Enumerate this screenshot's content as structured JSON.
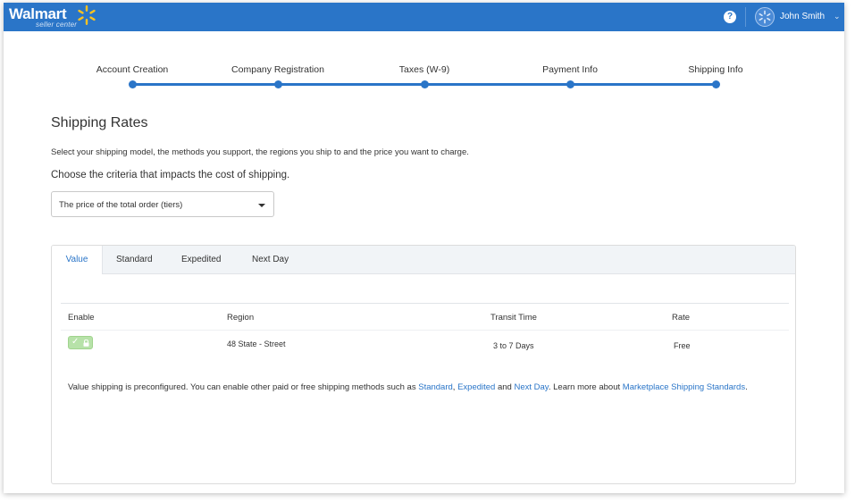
{
  "header": {
    "brand": "Walmart",
    "sub_brand": "seller center",
    "help_glyph": "?",
    "user_name": "John Smith",
    "caret": "⌄",
    "colors": {
      "bar": "#2a75c8",
      "spark": "#ffc220"
    }
  },
  "steps": [
    {
      "label": "Account Creation"
    },
    {
      "label": "Company Registration"
    },
    {
      "label": "Taxes (W-9)"
    },
    {
      "label": "Payment Info"
    },
    {
      "label": "Shipping Info"
    }
  ],
  "page": {
    "title": "Shipping Rates",
    "instructions": "Select your shipping model, the methods you support, the regions you ship to and the price you want to charge.",
    "criteria_label": "Choose the criteria that impacts the cost of shipping.",
    "criteria_selected": "The price of the total order (tiers)"
  },
  "tabs": [
    {
      "label": "Value",
      "active": true
    },
    {
      "label": "Standard"
    },
    {
      "label": "Expedited"
    },
    {
      "label": "Next Day"
    }
  ],
  "table": {
    "columns": [
      "Enable",
      "Region",
      "Transit Time",
      "Rate"
    ],
    "rows": [
      {
        "enabled": true,
        "locked": true,
        "region": "48 State - Street",
        "transit": "3 to 7 Days",
        "rate": "Free"
      }
    ]
  },
  "note": {
    "part1": "Value shipping is preconfigured. You can enable other paid or free shipping methods such as ",
    "link_standard": "Standard",
    "sep1": ", ",
    "link_expedited": "Expedited",
    "part2": " and ",
    "link_nextday": "Next Day",
    "part3": ". Learn more about ",
    "link_standards": "Marketplace Shipping Standards",
    "part4": "."
  }
}
